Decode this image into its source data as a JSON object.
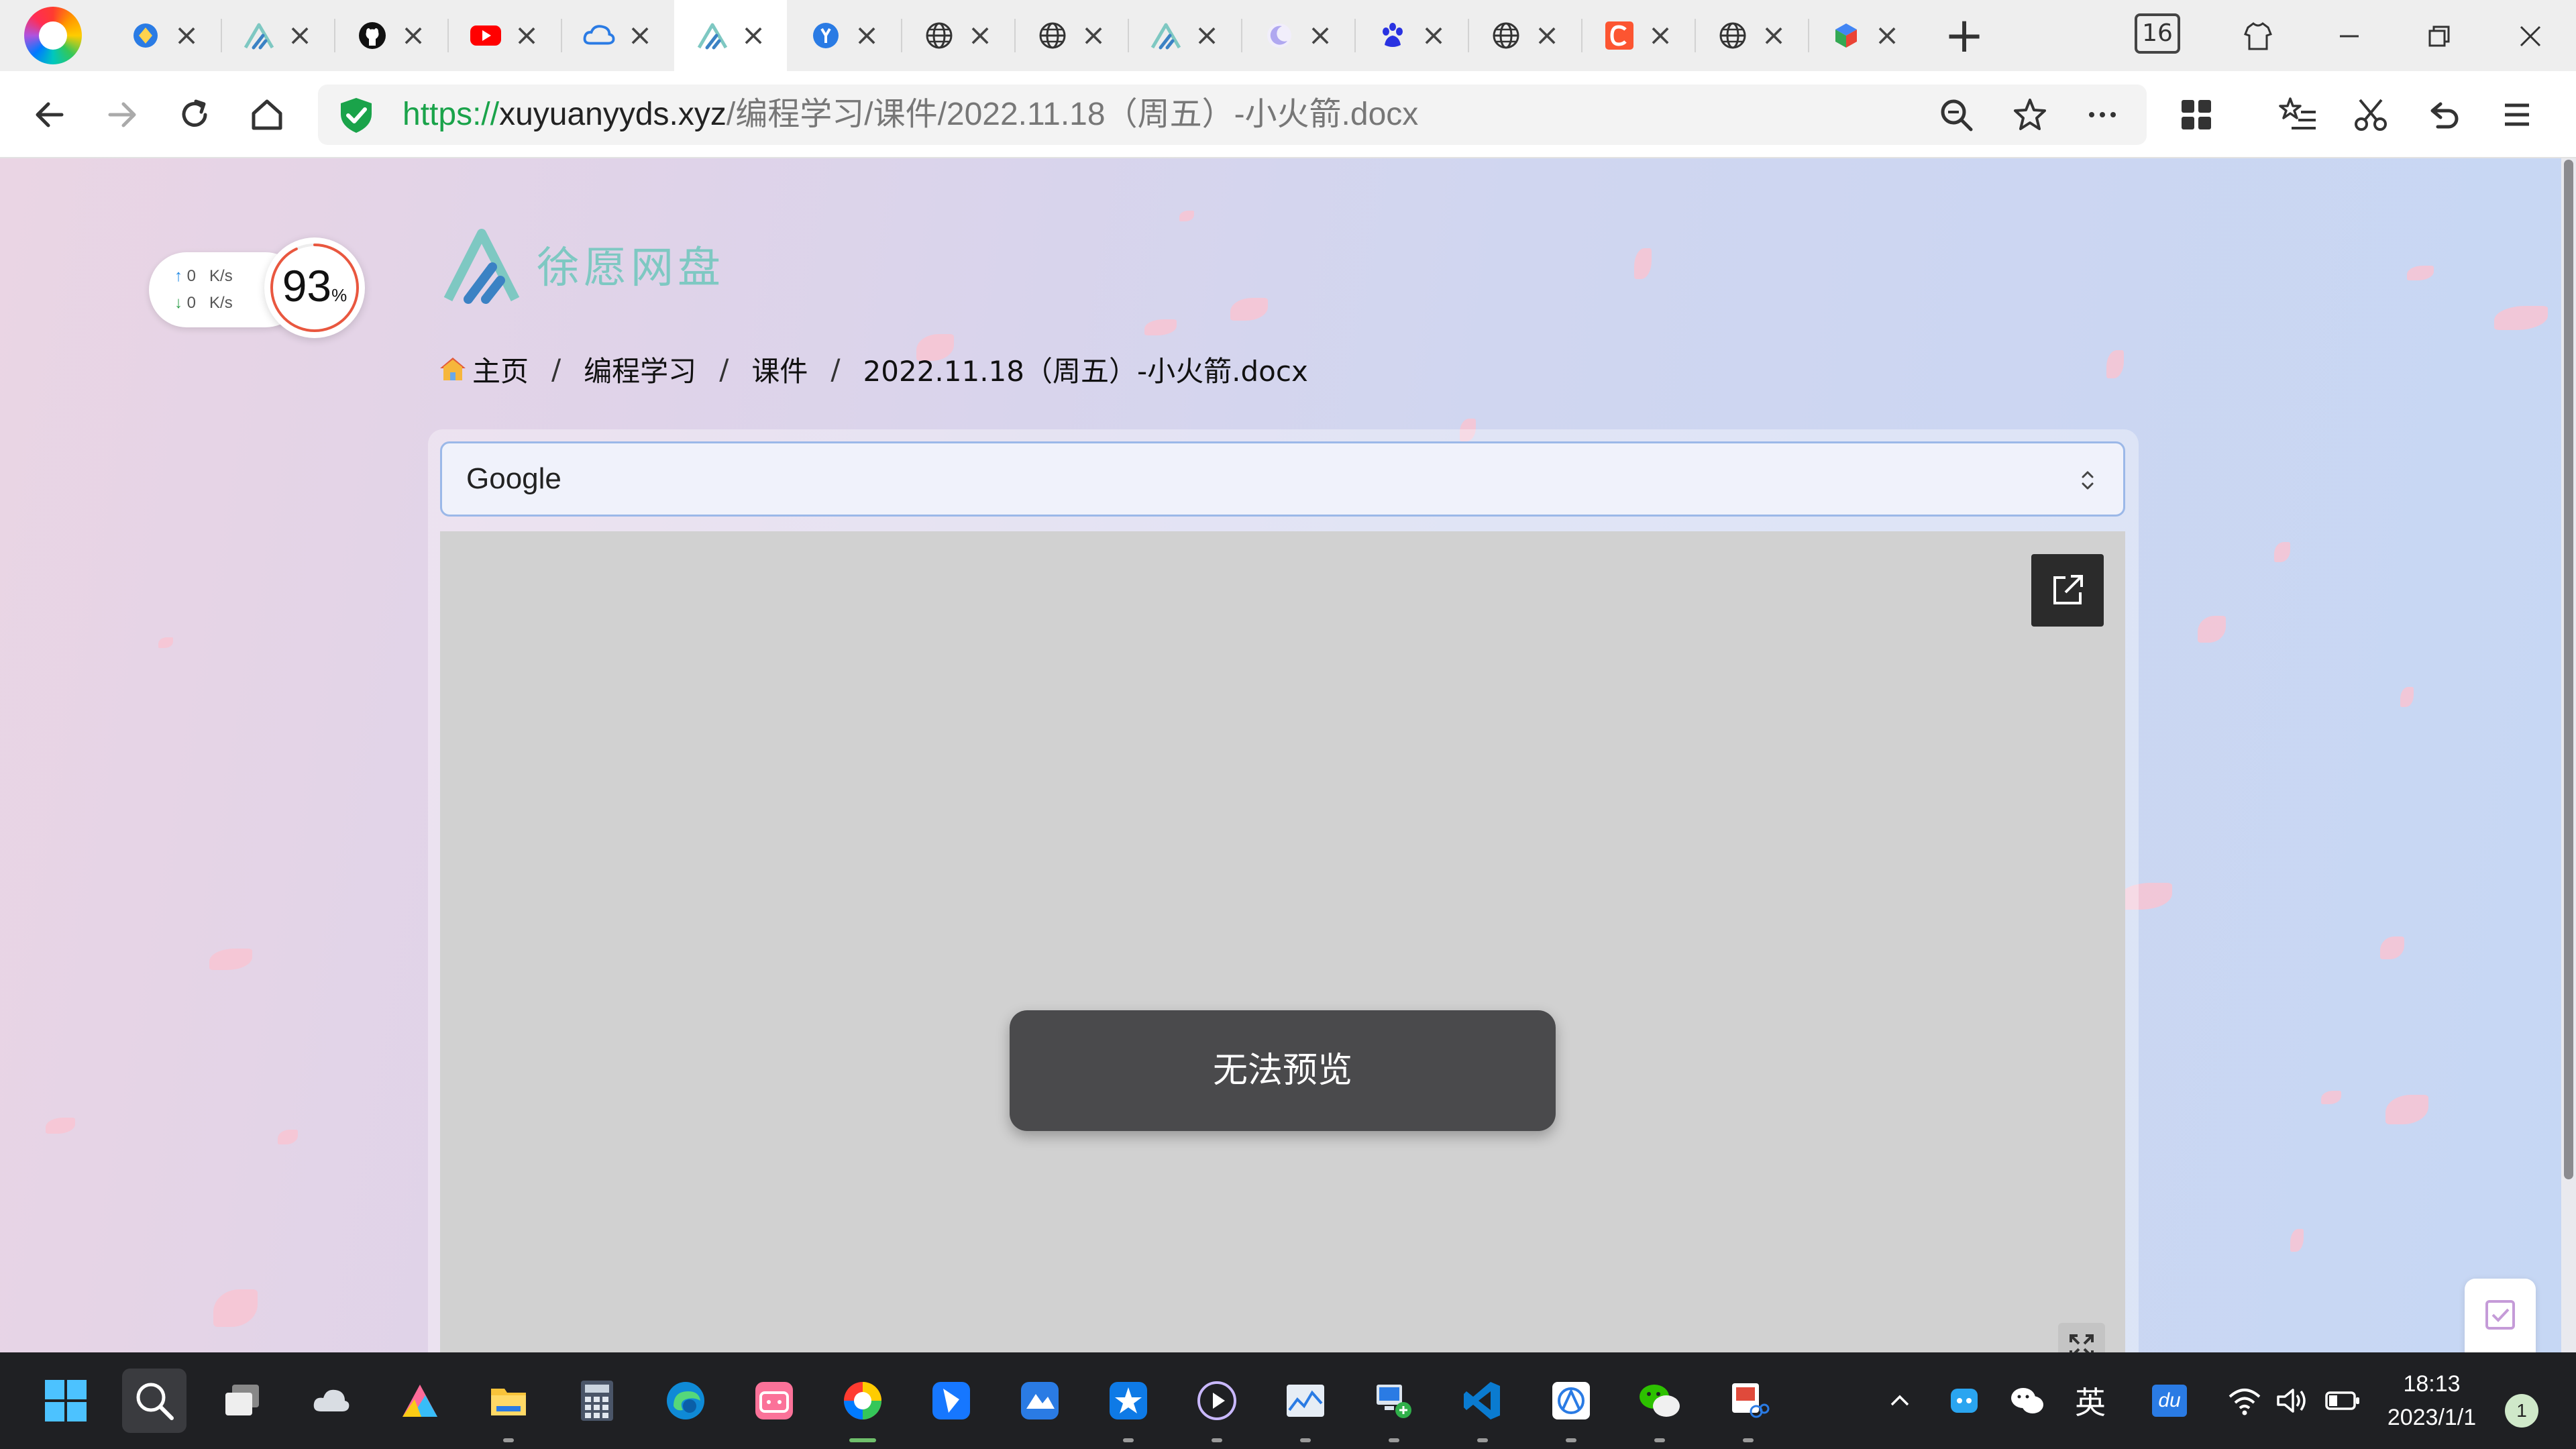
{
  "tabs": {
    "count_badge": "16",
    "new_tab_symbol": "+",
    "close_symbol": "×",
    "items": [
      {
        "icon": "blue-diamond-icon",
        "color": "#2a7be4"
      },
      {
        "icon": "xuyuan-logo-icon",
        "color": "#7ec8c2"
      },
      {
        "icon": "github-icon",
        "color": "#111111"
      },
      {
        "icon": "youtube-icon",
        "color": "#ff0000"
      },
      {
        "icon": "cloud-drive-icon",
        "color": "#2a7be4"
      },
      {
        "icon": "xuyuan-logo-icon",
        "color": "#7ec8c2",
        "active": true
      },
      {
        "icon": "yandex-translate-icon",
        "color": "#2a7be4"
      },
      {
        "icon": "globe-icon",
        "color": "#333333"
      },
      {
        "icon": "globe-icon",
        "color": "#333333"
      },
      {
        "icon": "xuyuan-logo-icon",
        "color": "#7ec8c2"
      },
      {
        "icon": "moon-icon",
        "color": "#b0a8f0"
      },
      {
        "icon": "baidu-paw-icon",
        "color": "#2932e1"
      },
      {
        "icon": "globe-icon",
        "color": "#333333"
      },
      {
        "icon": "csdn-icon",
        "color": "#fc5531"
      },
      {
        "icon": "globe-icon",
        "color": "#333333"
      },
      {
        "icon": "colorful-cube-icon",
        "color": "#34a853"
      }
    ]
  },
  "address_bar": {
    "scheme": "https://",
    "host": "xuyuanyyds.xyz",
    "path": "/编程学习/课件/2022.11.18（周五）-小火箭.docx"
  },
  "speed_widget": {
    "upload": "0",
    "download": "0",
    "unit": "K/s",
    "percent": "93",
    "percent_sign": "%",
    "percent_value": 93
  },
  "site": {
    "name": "徐愿网盘",
    "brand_color": "#7ec8c2"
  },
  "breadcrumb": {
    "home": "主页",
    "separator": "/",
    "items": [
      "编程学习",
      "课件",
      "2022.11.18（周五）-小火箭.docx"
    ]
  },
  "viewer": {
    "selected": "Google",
    "message": "无法预览"
  },
  "taskbar": {
    "apps": [
      "windows-start-icon",
      "search-icon",
      "task-view-icon",
      "weather-icon",
      "alist-icon",
      "file-explorer-icon",
      "calculator-icon",
      "edge-icon",
      "bilibili-icon",
      "browser-icon",
      "feishu-icon",
      "app-icon",
      "star-app-icon",
      "media-player-icon",
      "task-manager-icon",
      "network-app-icon",
      "vscode-icon",
      "translate-app-icon",
      "wechat-icon",
      "snipping-icon"
    ],
    "tray_language": "英",
    "tray_du": "du",
    "time": "18:13",
    "date": "2023/1/1",
    "notifications": "1"
  }
}
